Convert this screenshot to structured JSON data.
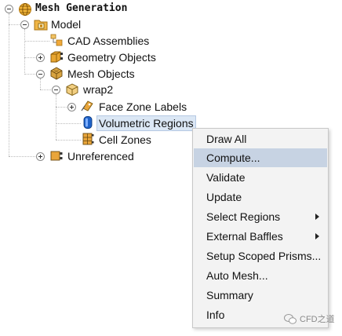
{
  "tree": {
    "root": {
      "label": "Mesh Generation",
      "icon": "globe-icon"
    },
    "model": {
      "label": "Model",
      "icon": "model-folder-icon"
    },
    "cad": {
      "label": "CAD Assemblies",
      "icon": "cad-assemblies-icon"
    },
    "geometry": {
      "label": "Geometry Objects",
      "icon": "geometry-objects-icon"
    },
    "mesh_objects": {
      "label": "Mesh Objects",
      "icon": "mesh-objects-icon"
    },
    "wrap2": {
      "label": "wrap2",
      "icon": "box-object-icon"
    },
    "face_zone": {
      "label": "Face Zone Labels",
      "icon": "face-zone-labels-icon"
    },
    "volumetric": {
      "label": "Volumetric Regions",
      "icon": "volumetric-regions-icon"
    },
    "cell_zones": {
      "label": "Cell Zones",
      "icon": "cell-zones-icon"
    },
    "unreferenced": {
      "label": "Unreferenced",
      "icon": "unreferenced-icon"
    }
  },
  "context_menu": {
    "items": [
      {
        "label": "Draw All",
        "submenu": false
      },
      {
        "label": "Compute...",
        "submenu": false,
        "highlighted": true
      },
      {
        "label": "Validate",
        "submenu": false
      },
      {
        "label": "Update",
        "submenu": false
      },
      {
        "label": "Select Regions",
        "submenu": true
      },
      {
        "label": "External Baffles",
        "submenu": true
      },
      {
        "label": "Setup Scoped Prisms...",
        "submenu": false
      },
      {
        "label": "Auto Mesh...",
        "submenu": false
      },
      {
        "label": "Summary",
        "submenu": false
      },
      {
        "label": "Info",
        "submenu": false
      }
    ]
  },
  "watermark": {
    "text": "CFD之道"
  }
}
